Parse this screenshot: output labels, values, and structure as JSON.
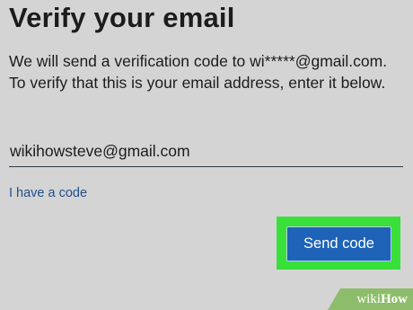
{
  "heading": "Verify your email",
  "description": "We will send a verification code to wi*****@gmail.com. To verify that this is your email address, enter it below.",
  "email_input": {
    "value": "wikihowsteve@gmail.com"
  },
  "have_code_link": "I have a code",
  "send_button": "Send code",
  "watermark": {
    "part1": "wiki",
    "part2": "How"
  },
  "colors": {
    "background": "#d4d4d4",
    "link": "#1f4f8c",
    "button": "#1e63b8",
    "highlight": "#39e03a",
    "watermark": "#8dbd6a"
  }
}
